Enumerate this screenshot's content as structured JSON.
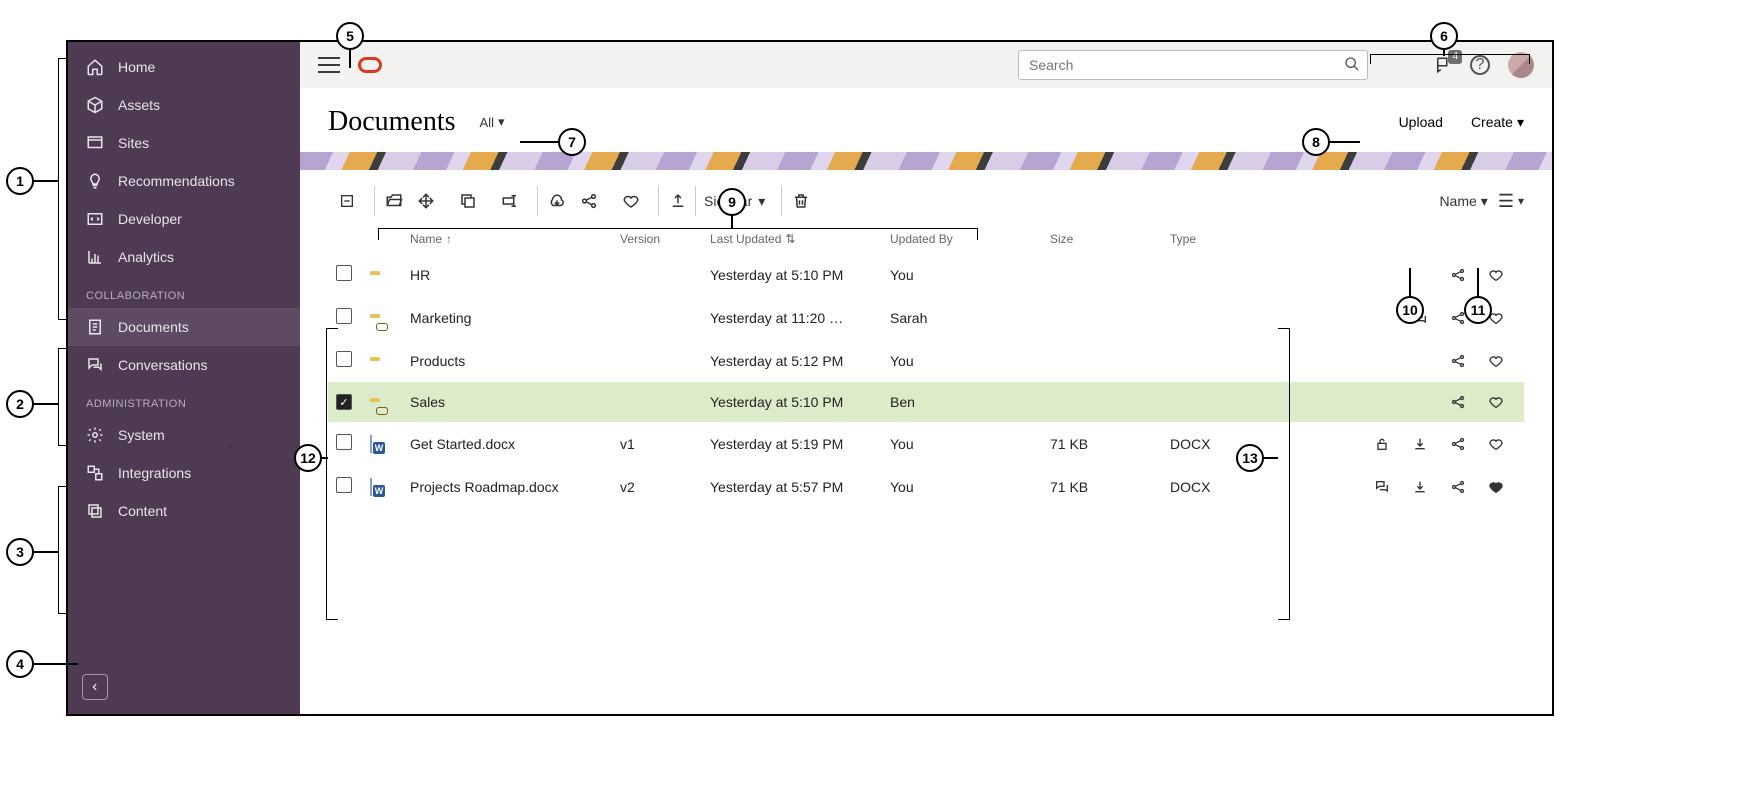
{
  "sidebar": {
    "top": [
      {
        "label": "Home",
        "icon": "home"
      },
      {
        "label": "Assets",
        "icon": "cube"
      },
      {
        "label": "Sites",
        "icon": "sites"
      },
      {
        "label": "Recommendations",
        "icon": "bulb"
      },
      {
        "label": "Developer",
        "icon": "dev"
      },
      {
        "label": "Analytics",
        "icon": "chart"
      }
    ],
    "sections": [
      {
        "title": "COLLABORATION",
        "items": [
          {
            "label": "Documents",
            "icon": "docs",
            "active": true
          },
          {
            "label": "Conversations",
            "icon": "chat"
          }
        ]
      },
      {
        "title": "ADMINISTRATION",
        "items": [
          {
            "label": "System",
            "icon": "gear"
          },
          {
            "label": "Integrations",
            "icon": "integ"
          },
          {
            "label": "Content",
            "icon": "content"
          }
        ]
      }
    ]
  },
  "topbar": {
    "search_placeholder": "Search",
    "notif_count": "4"
  },
  "header": {
    "title": "Documents",
    "filter": "All",
    "upload": "Upload",
    "create": "Create"
  },
  "toolbar": {
    "sidebar_label": "Sidebar",
    "sort_label": "Name"
  },
  "columns": {
    "name": "Name",
    "version": "Version",
    "updated": "Last Updated",
    "by": "Updated By",
    "size": "Size",
    "type": "Type"
  },
  "rows": [
    {
      "kind": "folder",
      "shared": false,
      "name": "HR",
      "ver": "",
      "upd": "Yesterday at 5:10 PM",
      "by": "You",
      "size": "",
      "type": "",
      "sel": false,
      "actions": [
        "share",
        "fav"
      ]
    },
    {
      "kind": "folder",
      "shared": true,
      "name": "Marketing",
      "ver": "",
      "upd": "Yesterday at 11:20 …",
      "by": "Sarah",
      "size": "",
      "type": "",
      "sel": false,
      "actions": [
        "conv",
        "share",
        "fav"
      ]
    },
    {
      "kind": "folder",
      "shared": false,
      "name": "Products",
      "ver": "",
      "upd": "Yesterday at 5:12 PM",
      "by": "You",
      "size": "",
      "type": "",
      "sel": false,
      "actions": [
        "share",
        "fav"
      ]
    },
    {
      "kind": "folder",
      "shared": true,
      "name": "Sales",
      "ver": "",
      "upd": "Yesterday at 5:10 PM",
      "by": "Ben",
      "size": "",
      "type": "",
      "sel": true,
      "actions": [
        "share",
        "fav"
      ]
    },
    {
      "kind": "docx",
      "name": "Get Started.docx",
      "ver": "v1",
      "upd": "Yesterday at 5:19 PM",
      "by": "You",
      "size": "71 KB",
      "type": "DOCX",
      "sel": false,
      "actions": [
        "lock",
        "dl",
        "share",
        "fav"
      ]
    },
    {
      "kind": "docx",
      "name": "Projects Roadmap.docx",
      "ver": "v2",
      "upd": "Yesterday at 5:57 PM",
      "by": "You",
      "size": "71 KB",
      "type": "DOCX",
      "sel": false,
      "actions": [
        "conv",
        "dl",
        "share",
        "favon"
      ]
    }
  ],
  "callouts": [
    "1",
    "2",
    "3",
    "4",
    "5",
    "6",
    "7",
    "8",
    "9",
    "10",
    "11",
    "12",
    "13"
  ]
}
